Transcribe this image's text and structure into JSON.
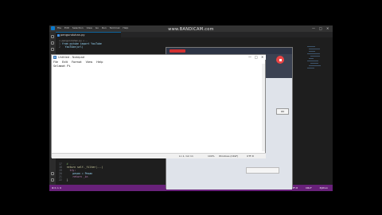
{
  "recorder_watermark": "www.BANDICAM.com",
  "vscode": {
    "menu": [
      "File",
      "Edit",
      "Selection",
      "View",
      "Go",
      "Run",
      "Terminal",
      "Help"
    ],
    "window_controls": [
      "—",
      "□",
      "✕"
    ],
    "tab": {
      "label": "pengunduhan.py"
    },
    "breadcrumb": "> pengunduhan.py > ...",
    "code_top": [
      {
        "n": "1",
        "text": "from pytube import YouTube"
      },
      {
        "n": "2",
        "text": "  YouTube(url)"
      }
    ],
    "code_bottom": [
      {
        "n": "17",
        "text": "  # ..."
      },
      {
        "n": "18",
        "text": "  return self._filter(...)"
      },
      {
        "n": "19",
        "text": "    try:"
      },
      {
        "n": "20",
        "text": "      pesan = Pesan"
      },
      {
        "n": "21",
        "text": "      return _in"
      },
      {
        "n": "22",
        "text": "  }"
      }
    ],
    "status_left": "⊗ 0 ⚠ 0",
    "status_right": [
      "Ln 1, Col 1",
      "Spaces: 4",
      "UTF-8",
      "CRLF",
      "Python"
    ]
  },
  "bandicam": {
    "logo": "BANDICAM",
    "button": "OK"
  },
  "notepad": {
    "title": "Untitled - Notepad",
    "window_controls": [
      "—",
      "□",
      "✕"
    ],
    "menu": [
      "File",
      "Edit",
      "Format",
      "View",
      "Help"
    ],
    "content": "Selamat Pi",
    "status": [
      "Ln 1, Col 11",
      "100%",
      "Windows (CRLF)",
      "UTF-8"
    ]
  },
  "colors": {
    "accent": "#68217a",
    "record": "#e94444"
  }
}
